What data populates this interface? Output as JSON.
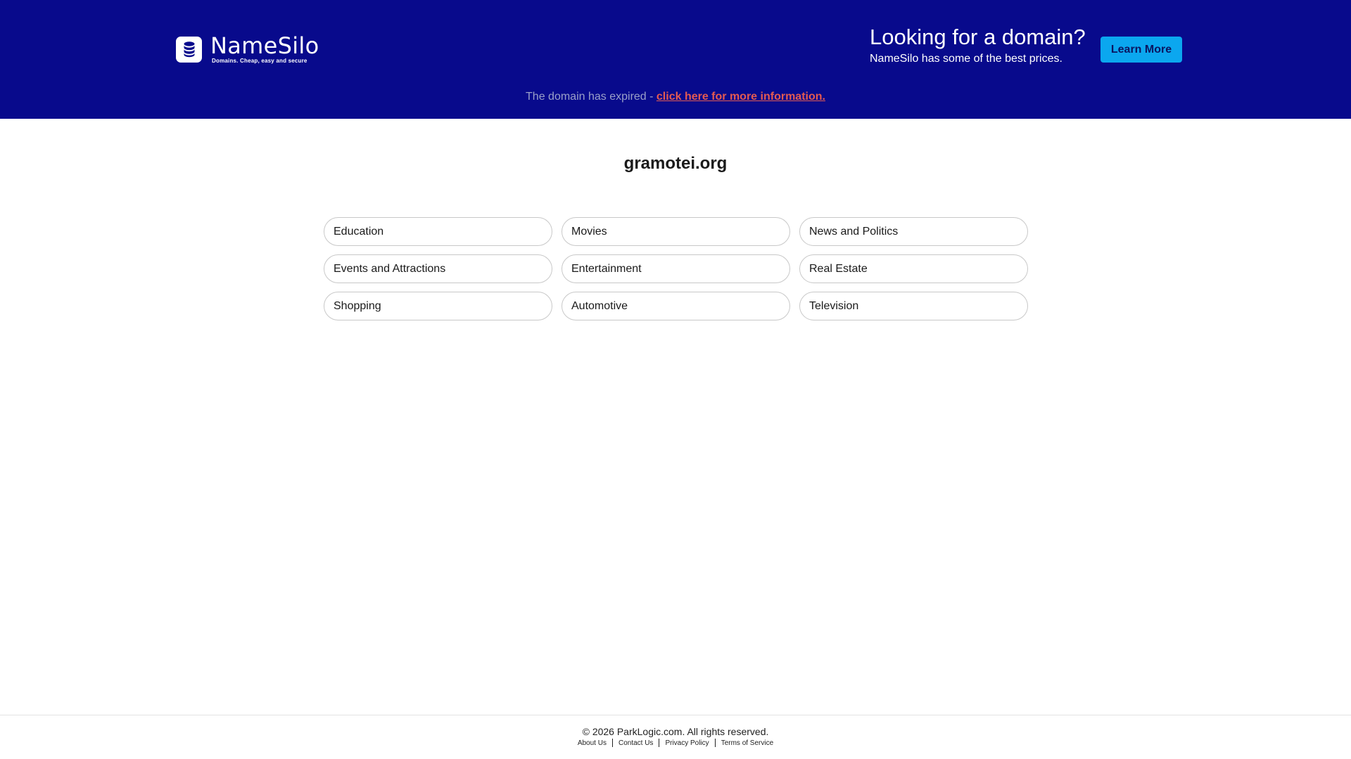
{
  "header": {
    "logo": {
      "name": "NameSilo",
      "tagline": "Domains. Cheap, easy and secure"
    },
    "promo": {
      "heading": "Looking for a domain?",
      "subtext": "NameSilo has some of the best prices.",
      "button_label": "Learn More"
    },
    "expired_notice": {
      "text": "The domain has expired - ",
      "link_text": "click here for more information."
    }
  },
  "main": {
    "domain": "gramotei.org",
    "categories": [
      "Education",
      "Movies",
      "News and Politics",
      "Events and Attractions",
      "Entertainment",
      "Real Estate",
      "Shopping",
      "Automotive",
      "Television"
    ]
  },
  "footer": {
    "copyright": "© 2026 ParkLogic.com. All rights reserved.",
    "links": [
      "About Us",
      "Contact Us",
      "Privacy Policy",
      "Terms of Service"
    ]
  },
  "colors": {
    "header_bg": "#080a8c",
    "button_bg": "#0ba7ef",
    "link_red": "#e35a52"
  },
  "icons": {
    "logo": "database-icon"
  }
}
